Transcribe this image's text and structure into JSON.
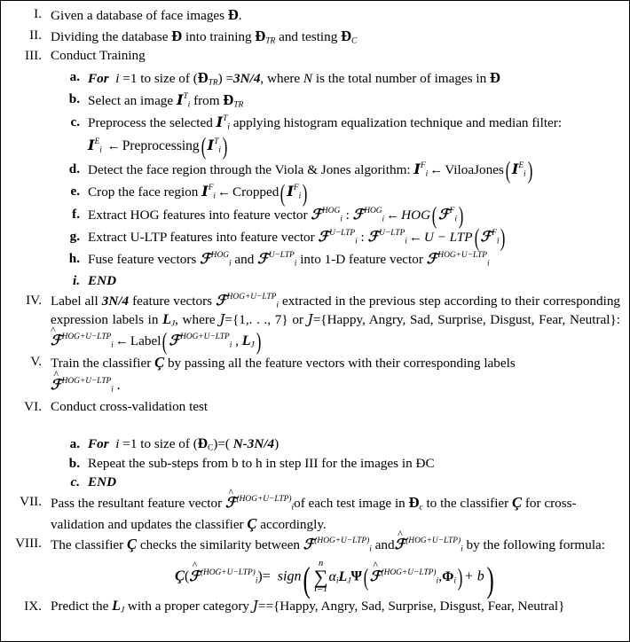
{
  "document": {
    "type": "algorithm-pseudocode",
    "title": "Facial Expression Recognition Algorithm (HOG + U-LTP)",
    "symbols": {
      "database": "Ð",
      "database_train": "Ð_TR",
      "database_test": "Ð_C",
      "image": "I",
      "feature_vector": "ℱ",
      "label_set": "L_J",
      "classifier": "Ç"
    }
  },
  "steps": [
    {
      "num": "I.",
      "text_plain": "Given a database of face images Ð.",
      "parts": {
        "p1": "Given a database of face images ",
        "p2": "Ð",
        "p3": "."
      }
    },
    {
      "num": "II.",
      "text_plain": "Dividing the database Ð into training Ð_TR and testing Ð_C",
      "parts": {
        "p1": "Dividing the database ",
        "d1": "Ð",
        "p2": " into training ",
        "d2": "Ð",
        "sub2": "TR",
        "p3": " and testing ",
        "d3": "Ð",
        "sub3": "C"
      }
    },
    {
      "num": "III.",
      "text_plain": "Conduct Training",
      "parts": {
        "p1": "Conduct Training"
      },
      "substeps": [
        {
          "label": "a.",
          "italic_label": false,
          "text_plain": "For i =1 to size of (Ð_TR) =3N/4, where N is the total number of images in Ð",
          "parts": {
            "kw": "For",
            "p1": "i",
            "p2": " =1 to size of (",
            "d1": "Ð",
            "sub1": "TR",
            "p3": ") =",
            "val": "3N/4",
            "p4": ", where ",
            "n": "N",
            "p5": " is the total number of images in ",
            "d2": "Ð"
          }
        },
        {
          "label": "b.",
          "text_plain": "Select an image I_i^T from Ð_TR",
          "parts": {
            "p1": "Select an image ",
            "sym": "I",
            "sup": "T",
            "sub": "i",
            "p2": " from ",
            "d1": "Ð",
            "dsub": "TR"
          }
        },
        {
          "label": "c.",
          "text_plain": "Preprocess the selected I_i^T applying histogram equalization technique and median filter: I_i^E ← Preprocessing(I_i^T)",
          "parts": {
            "p1": "Preprocess the selected ",
            "sym": "I",
            "sup": "T",
            "sub": "i",
            "p2": " applying histogram equalization technique and median filter:",
            "eq_lhs_sym": "I",
            "eq_lhs_sup": "E",
            "eq_lhs_sub": "i",
            "arrow": "←",
            "fn": "Preprocessing",
            "eq_arg_sym": "I",
            "eq_arg_sup": "T",
            "eq_arg_sub": "i"
          }
        },
        {
          "label": "d.",
          "text_plain": "Detect the face region through the Viola & Jones algorithm: I_i^F ← ViloaJones(I_i^E)",
          "parts": {
            "p1": "Detect the face region through the Viola & Jones algorithm:  ",
            "lhs": "I",
            "lhs_sup": "F",
            "lhs_sub": "i",
            "arrow": "←",
            "fn": "ViloaJones",
            "arg": "I",
            "arg_sup": "E",
            "arg_sub": "i"
          }
        },
        {
          "label": "e.",
          "text_plain": "Crop the face region I_i^F ← Cropped(I_i^F)",
          "parts": {
            "p1": "Crop the face region ",
            "lhs": "I",
            "lhs_sup": "F",
            "lhs_sub": "i",
            "arrow": "←",
            "fn": "Cropped",
            "arg": "I",
            "arg_sup": "F",
            "arg_sub": "i"
          }
        },
        {
          "label": "f.",
          "text_plain": "Extract HOG features into feature vector ℱ_i^HOG : ℱ_i^HOG ← HOG(ℱ_i^F)",
          "parts": {
            "p1": "Extract HOG features into feature vector ",
            "v1": "ℱ",
            "v1_sup": "HOG",
            "v1_sub": "i",
            "colon": " : ",
            "v2": "ℱ",
            "v2_sup": "HOG",
            "v2_sub": "i",
            "arrow": "←",
            "fn": "HOG",
            "arg": "ℱ",
            "arg_sup": "F",
            "arg_sub": "i"
          }
        },
        {
          "label": "g.",
          "text_plain": "Extract U-LTP features into feature vector ℱ_i^U−LTP : ℱ_i^U−LTP ← U − LTP(ℱ_i^F)",
          "parts": {
            "p1": "Extract U-LTP features into feature vector ",
            "v1": "ℱ",
            "v1_sup": "U−LTP",
            "v1_sub": "i",
            "colon": " : ",
            "v2": "ℱ",
            "v2_sup": "U−LTP",
            "v2_sub": "i",
            "arrow": "←",
            "fn": "U − LTP",
            "arg": "ℱ",
            "arg_sup": "F",
            "arg_sub": "i"
          }
        },
        {
          "label": "h.",
          "text_plain": "Fuse feature vectors ℱ_i^HOG and ℱ_i^U−LTP into 1-D feature vector ℱ_i^HOG+U−LTP",
          "parts": {
            "p1": "Fuse feature vectors ",
            "v1": "ℱ",
            "v1_sup": "HOG",
            "v1_sub": "i",
            "p2": " and ",
            "v2": "ℱ",
            "v2_sup": "U−LTP",
            "v2_sub": "i",
            "p3": " into 1-D feature vector ",
            "v3": "ℱ",
            "v3_sup": "HOG+U−LTP",
            "v3_sub": "i"
          }
        },
        {
          "label": "i.",
          "italic_label": true,
          "text_plain": "END",
          "parts": {
            "kw": "END"
          }
        }
      ]
    },
    {
      "num": "IV.",
      "text_plain": "Label all 3N/4 feature vectors ℱ_i^HOG+U−LTP extracted in the previous step according to their corresponding expression labels in L_J, where J={1,. . ., 7} or J={Happy, Angry, Sad, Surprise, Disgust, Fear, Neutral}: ℱ̂_i^HOG+U−LTP ← Label(ℱ_i^HOG+U−LTP , L_J )",
      "parts": {
        "p1": "Label all ",
        "val": "3N/4",
        "p2": " feature vectors ",
        "v1": "ℱ",
        "v1_sup": "HOG+U−LTP",
        "v1_sub": "i",
        "p3": " extracted in the previous step according to their corresponding expression labels in ",
        "lsym": "L",
        "lsub": "J",
        "p4": ", where ",
        "j1": "J",
        "p5": "={1,. . ., 7} or ",
        "j2": "J",
        "p6": "={Happy, Angry, Sad, Surprise, Disgust, Fear, Neutral}: ",
        "hat_v": "ℱ",
        "hat_sup": "HOG+U−LTP",
        "hat_sub": "i",
        "arrow": "←",
        "fn": "Label",
        "arg": "ℱ",
        "arg_sup": "HOG+U−LTP",
        "arg_sub": "i",
        "comma": " , ",
        "arg_l": "L",
        "arg_l_sub": "J"
      }
    },
    {
      "num": "V.",
      "text_plain": "Train the classifier Ç by passing all the feature vectors with their corresponding labels ℱ̂_i^HOG+U−LTP .",
      "parts": {
        "p1": "Train the classifier ",
        "c": "Ç",
        "p2": " by passing all the feature vectors with their corresponding labels",
        "hat_v": "ℱ",
        "hat_sup": "HOG+U−LTP",
        "hat_sub": "i",
        "period": " ."
      }
    },
    {
      "num": "VI.",
      "text_plain": "Conduct cross-validation test",
      "parts": {
        "p1": "Conduct cross-validation test"
      },
      "substeps": [
        {
          "label": "a.",
          "text_plain": "For i =1 to size of (Ð_C)=( N-3N/4)",
          "parts": {
            "kw": "For",
            "p1": "i",
            "p2": " =1 to size of (",
            "d1": "Ð",
            "sub1": "C",
            "p3": ")=( ",
            "val": "N-3N/4",
            "p4": ")"
          }
        },
        {
          "label": "b.",
          "text_plain": "Repeat the sub-steps from b to h in step III for the images in ÐC",
          "parts": {
            "p1": "Repeat the sub-steps from b to h in step III for the images in ÐC"
          }
        },
        {
          "label": "c.",
          "italic_label": true,
          "text_plain": "END",
          "parts": {
            "kw": "END"
          }
        }
      ]
    },
    {
      "num": "VII.",
      "text_plain": "Pass the resultant feature vector ℱ̂_i^(HOG+U−LTP) of each test image in Ð_c to the classifier Ç for cross-validation and updates the classifier Ç accordingly.",
      "parts": {
        "p1": "Pass the resultant feature vector ",
        "hat_v": "ℱ",
        "hat_sup": "(HOG+U−LTP)",
        "hat_sub": "i",
        "p2": "of each test image in ",
        "d1": "Ð",
        "dsub": "c",
        "p3": " to the classifier ",
        "c1": "Ç",
        "p4": " for cross-validation and updates the classifier ",
        "c2": "Ç",
        "p5": " accordingly."
      }
    },
    {
      "num": "VIII.",
      "text_plain": "The classifier Ç checks the similarity between ℱ_i^(HOG+U−LTP) and ℱ̂_i^(HOG+U−LTP) by the following formula:",
      "parts": {
        "p1": "The classifier ",
        "c": "Ç",
        "p2": " checks the similarity between ",
        "v1": "ℱ",
        "v1_sup": "(HOG+U−LTP)",
        "v1_sub": "i",
        "p3": " and",
        "hat_v": "ℱ",
        "hat_sup": "(HOG+U−LTP)",
        "hat_sub": "i",
        "p4": " by the following formula:"
      },
      "formula": {
        "lhs_c": "Ç",
        "lhs_open": "(",
        "lhs_v": "ℱ",
        "lhs_sup": "(HOG+U−LTP)",
        "lhs_sub": "i",
        "lhs_close": ")",
        "equals": "=",
        "fn": "sign",
        "sum_sym": "∑",
        "sum_upper": "n",
        "sum_lower": "i=1",
        "alpha": "α",
        "alpha_sub": "i",
        "l_sym": "L",
        "l_sub": "J",
        "psi": "Ψ",
        "arg_v": "ℱ",
        "arg_sup": "(HOG+U−LTP)",
        "arg_sub": "i",
        "comma": ",",
        "phi": "Φ",
        "phi_sub": "i",
        "plus_b": "+ b"
      }
    },
    {
      "num": "IX.",
      "text_plain": "Predict the L_J with a proper category J=={Happy, Angry, Sad, Surprise, Disgust, Fear, Neutral}",
      "parts": {
        "p1": "Predict the ",
        "lsym": "L",
        "lsub": "J",
        "p2": " with a proper category ",
        "j": "J",
        "p3": "=={Happy, Angry, Sad, Surprise, Disgust, Fear, Neutral}"
      }
    }
  ]
}
